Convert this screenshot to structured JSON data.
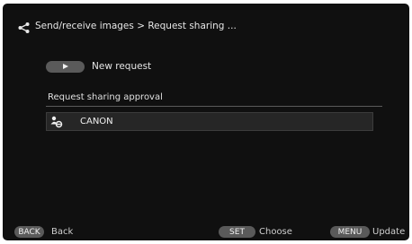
{
  "header": {
    "icon": "share-icon",
    "title": "Send/receive images > Request sharing ..."
  },
  "new_request": {
    "button_icon": "play-icon",
    "label": "New request"
  },
  "approval_section": {
    "label": "Request sharing approval",
    "devices": [
      {
        "icon": "person-with-link-icon",
        "name": "CANON"
      }
    ]
  },
  "footer": {
    "back_key": "BACK",
    "back_label": "Back",
    "set_key": "SET",
    "set_label": "Choose",
    "menu_key": "MENU",
    "menu_label": "Update"
  }
}
